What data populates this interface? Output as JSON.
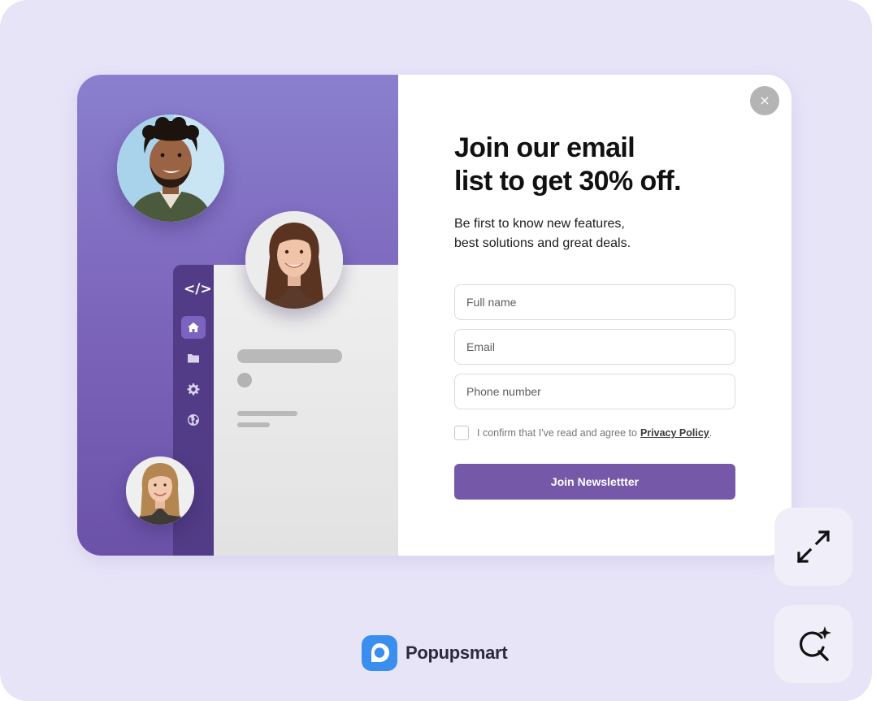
{
  "popup": {
    "headline_line1": "Join our email",
    "headline_line2": "list to get 30% off.",
    "subtext_line1": "Be first to know new features,",
    "subtext_line2": "best solutions and great deals.",
    "close_symbol": "×",
    "fields": {
      "full_name_placeholder": "Full name",
      "email_placeholder": "Email",
      "phone_placeholder": "Phone number"
    },
    "consent_text": "I confirm that I've read and agree to",
    "consent_link": "Privacy Policy",
    "consent_suffix": ".",
    "submit_label": "Join Newslettter"
  },
  "mock_app": {
    "logo_symbol": "</>",
    "sidebar_icons": [
      "home-icon",
      "folder-icon",
      "settings-icon",
      "globe-icon"
    ],
    "active_item": "home-icon"
  },
  "toolbar": {
    "expand_icon": "expand-icon",
    "ai_search_icon": "ai-search-icon"
  },
  "brand": {
    "name": "Popupsmart"
  },
  "colors": {
    "background": "#e8e4f8",
    "accent": "#7559a8",
    "panel_gradient_top": "#8a7fce",
    "panel_gradient_bottom": "#6b52a8",
    "sidebar": "#523c87",
    "brand_logo": "#3a8ef0"
  }
}
